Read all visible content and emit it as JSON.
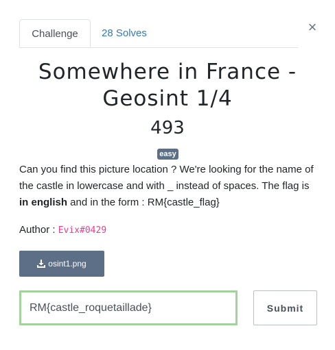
{
  "tabs": [
    {
      "label": "Challenge"
    },
    {
      "label": "28 Solves"
    }
  ],
  "close_label": "×",
  "challenge": {
    "title": "Somewhere in France - Geosint 1/4",
    "value": "493",
    "tag": "easy",
    "description": {
      "part1": "Can you find this picture location ? We're looking for the name of the castle in lowercase and with _ instead of spaces. The flag is ",
      "bold": "in english",
      "part2": " and in the form : RM{castle_flag}"
    },
    "author_label": "Author : ",
    "author_handle": "Evix#0429",
    "file_label": "osint1.png"
  },
  "submission": {
    "value": "RM{castle_roquetaillade}",
    "submit_label": "Submit"
  },
  "icons": {
    "download": "download-icon",
    "close": "close-icon"
  },
  "colors": {
    "link": "#337ab7",
    "tag_bg": "#5c6f87",
    "input_border": "#a3d39c",
    "author_code": "#e83e8c"
  }
}
